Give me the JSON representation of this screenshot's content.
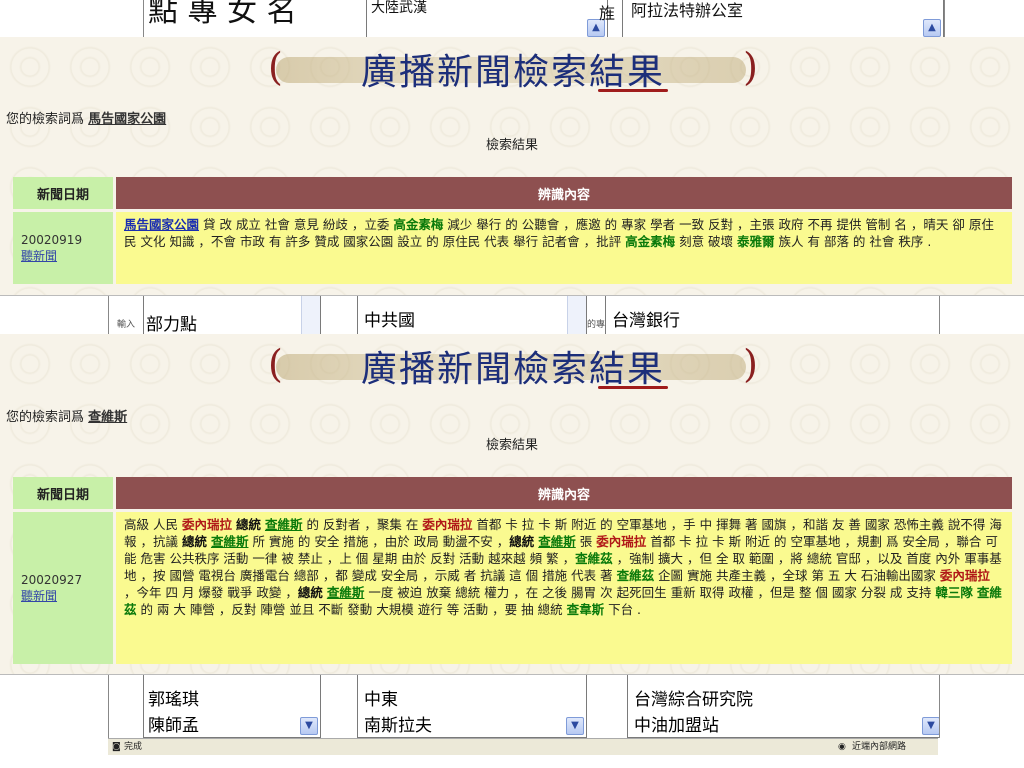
{
  "background": {
    "top_text_left": "點 專 女 名",
    "top_text_mid": "大陸武漢",
    "top_text_char": "旌",
    "top_text_right": "阿拉法特辦公室",
    "mid_label_left": "輸入",
    "mid_item_left_1": "部力點",
    "mid_item_center": "中共國",
    "mid_label_right": "的專",
    "mid_item_right": "台灣銀行",
    "bottom_left_items": [
      "郭瑤琪",
      "陳師孟"
    ],
    "bottom_center_items": [
      "中東",
      "南斯拉夫"
    ],
    "bottom_right_items": [
      "台灣綜合研究院",
      "中油加盟站"
    ],
    "status_left": "完成",
    "status_right": "近端內部網路"
  },
  "panels": [
    {
      "title": "廣播新聞檢索結果",
      "query_label": "您的檢索詞爲",
      "query_term": "馬告國家公園",
      "results_label": "檢索結果",
      "col_date": "新聞日期",
      "col_content": "辨識內容",
      "date": "20020919",
      "listen_link": "聽新聞"
    },
    {
      "title": "廣播新聞檢索結果",
      "query_label": "您的檢索詞爲",
      "query_term": "查維斯",
      "results_label": "檢索結果",
      "col_date": "新聞日期",
      "col_content": "辨識內容",
      "date": "20020927",
      "listen_link": "聽新聞"
    }
  ],
  "content1": [
    [
      "bl",
      "馬告國家公園"
    ],
    [
      "",
      " 貸 改 成立 社會 意見 紛歧 ，立委 "
    ],
    [
      "g",
      "高金素梅"
    ],
    [
      "",
      " 減少 舉行 的 公聽會 ，應邀 的 專家 學者 一致 反對 ，主張 政府 不再 提供 管制 名 ，晴天 卻 原住民 文化 知識 ，不會 市政 有 許多 贊成 國家公園 設立 的 原住民 代表 舉行 記者會 ，批評 "
    ],
    [
      "g",
      "高金素梅"
    ],
    [
      "",
      " 刻意 破壞 "
    ],
    [
      "g",
      "泰雅爾"
    ],
    [
      "",
      " 族人 有 部落 的 社會 秩序 ."
    ]
  ],
  "content2": [
    [
      "",
      "高級 人民 "
    ],
    [
      "r",
      "委內瑞拉"
    ],
    [
      "",
      " "
    ],
    [
      "b",
      "總統"
    ],
    [
      "",
      " "
    ],
    [
      "gu",
      "查維斯"
    ],
    [
      "",
      " 的 反對者 ，聚集 在 "
    ],
    [
      "r",
      "委內瑞拉"
    ],
    [
      "",
      " 首都 卡 拉 卡 斯 附近 的 空軍基地 ，手 中 揮舞 著 國旗 ，和諧 友 善 國家 恐怖主義 說不得 海報 ，抗議 "
    ],
    [
      "b",
      "總統"
    ],
    [
      "",
      " "
    ],
    [
      "gu",
      "查維斯"
    ],
    [
      "",
      " 所 實施 的 安全 措施 ，由於 政局 動盪不安 ，"
    ],
    [
      "b",
      "總統"
    ],
    [
      "",
      " "
    ],
    [
      "gu",
      "查維斯"
    ],
    [
      "",
      " 張 "
    ],
    [
      "r",
      "委內瑞拉"
    ],
    [
      "",
      " 首都 卡 拉 卡 斯 附近 的 空軍基地 ，規劃 爲 安全局 ，聯合 可能 危害 公共秩序 活動 一律 被 禁止 ，上 個 星期 由於 反對 活動 越來越 頻 繁 ，"
    ],
    [
      "g",
      "查維茲"
    ],
    [
      "",
      " ，強制 擴大 ，但 全 取 範圍 ，將 總統 官邸 ，以及 首度 內外 軍事基地 ，按 國營 電視台 廣播電台 總部 ，都 變成 安全局 ，示威 者 抗議 這 個 措施 代表 著 "
    ],
    [
      "g",
      "查維茲"
    ],
    [
      "",
      " 企圖 實施 共產主義 ，全球 第 五 大 石油輸出國家 "
    ],
    [
      "r",
      "委內瑞拉"
    ],
    [
      "",
      " ，今年 四 月 爆發 戰爭 政變 ，"
    ],
    [
      "b",
      "總統"
    ],
    [
      "",
      " "
    ],
    [
      "gu",
      "查維斯"
    ],
    [
      "",
      " 一度 被迫 放棄 總統 權力 ，在 之後 腸胃 次 起死回生 重新 取得 政權 ，但是 整 個 國家 分裂 成 支持 "
    ],
    [
      "g",
      "韓三隊"
    ],
    [
      "",
      " "
    ],
    [
      "g",
      "查維茲"
    ],
    [
      "",
      " 的 兩 大 陣營 ，反對 陣營 並且 不斷 發動 大規模 遊行 等 活動 ，要 抽 總統 "
    ],
    [
      "g",
      "查韋斯"
    ],
    [
      "",
      " 下台 ."
    ]
  ]
}
